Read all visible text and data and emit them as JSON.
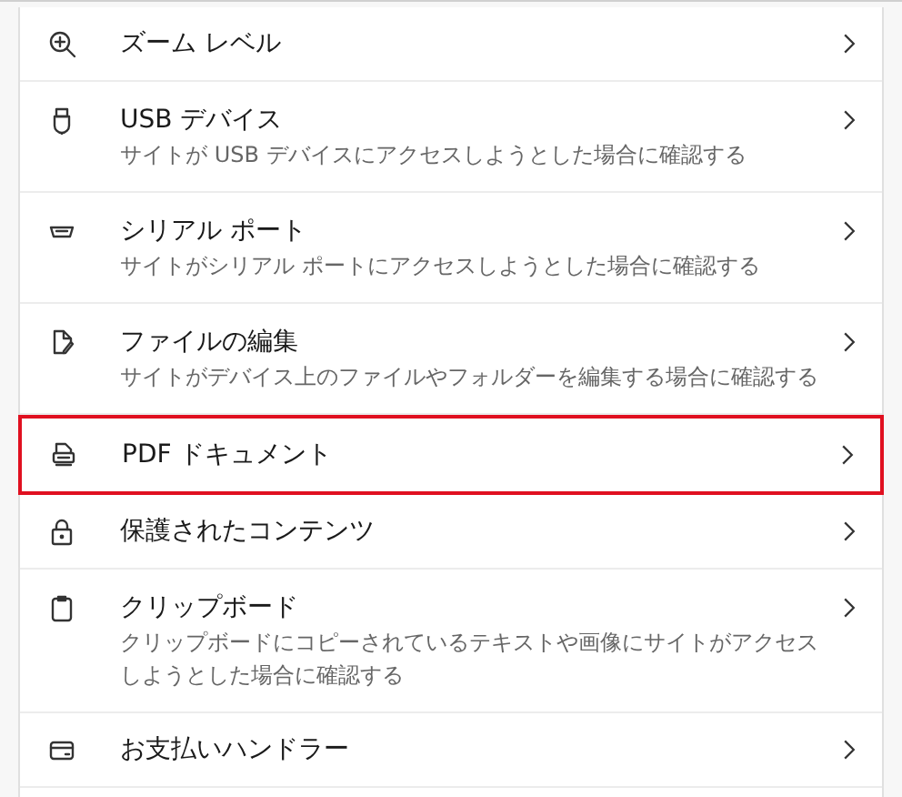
{
  "items": [
    {
      "title": "ズーム レベル",
      "highlighted": false
    },
    {
      "title": "USB デバイス",
      "description": "サイトが USB デバイスにアクセスしようとした場合に確認する",
      "highlighted": false
    },
    {
      "title": "シリアル ポート",
      "description": "サイトがシリアル ポートにアクセスしようとした場合に確認する",
      "highlighted": false
    },
    {
      "title": "ファイルの編集",
      "description": "サイトがデバイス上のファイルやフォルダーを編集する場合に確認する",
      "highlighted": false
    },
    {
      "title": "PDF ドキュメント",
      "highlighted": true
    },
    {
      "title": "保護されたコンテンツ",
      "highlighted": false
    },
    {
      "title": "クリップボード",
      "description": "クリップボードにコピーされているテキストや画像にサイトがアクセスしようとした場合に確認する",
      "highlighted": false
    },
    {
      "title": "お支払いハンドラー",
      "highlighted": false
    }
  ]
}
